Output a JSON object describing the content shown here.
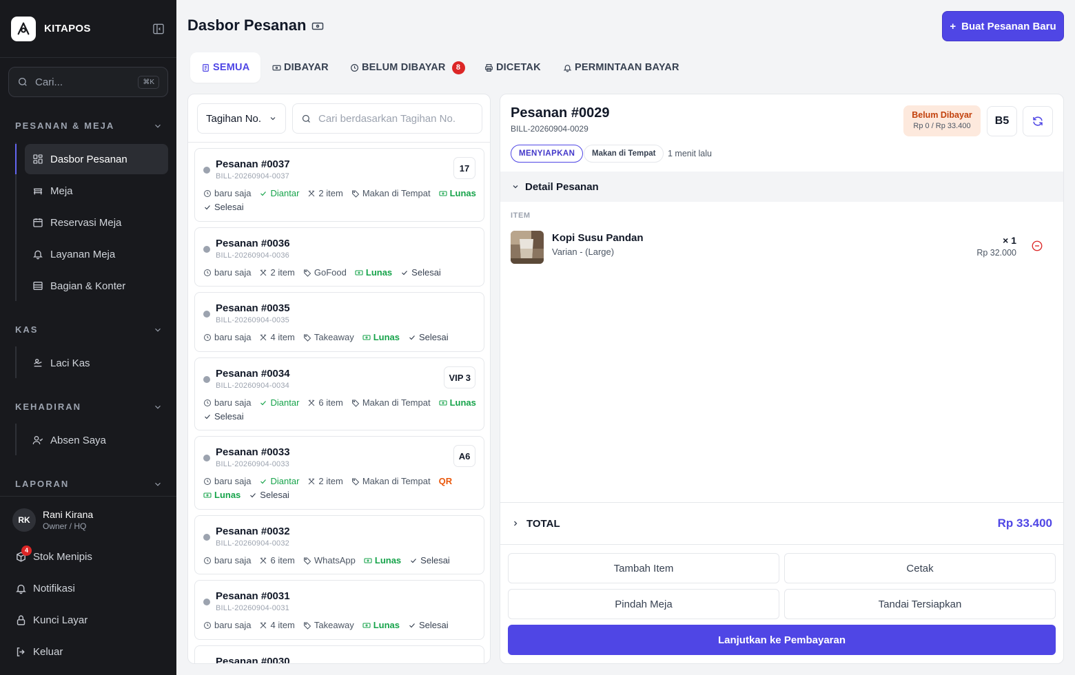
{
  "brand": {
    "name": "KITAPOS"
  },
  "sidebar": {
    "search": {
      "placeholder": "Cari...",
      "shortcut": "⌘K"
    },
    "sections": [
      {
        "title": "PESANAN & MEJA",
        "items": [
          {
            "label": "Dasbor Pesanan",
            "icon": "dashboard-icon",
            "active": true
          },
          {
            "label": "Meja",
            "icon": "table-icon"
          },
          {
            "label": "Reservasi Meja",
            "icon": "calendar-icon"
          },
          {
            "label": "Layanan Meja",
            "icon": "bell-icon"
          },
          {
            "label": "Bagian & Konter",
            "icon": "counter-icon"
          }
        ]
      },
      {
        "title": "KAS",
        "items": [
          {
            "label": "Laci Kas",
            "icon": "cash-icon"
          }
        ]
      },
      {
        "title": "KEHADIRAN",
        "items": [
          {
            "label": "Absen Saya",
            "icon": "user-check-icon"
          }
        ]
      },
      {
        "title": "LAPORAN",
        "items": []
      }
    ],
    "user": {
      "initials": "RK",
      "name": "Rani Kirana",
      "role": "Owner / HQ"
    },
    "bottom": [
      {
        "label": "Stok Menipis",
        "icon": "box-icon",
        "badge": "4"
      },
      {
        "label": "Notifikasi",
        "icon": "bell-icon"
      },
      {
        "label": "Kunci Layar",
        "icon": "lock-icon"
      },
      {
        "label": "Keluar",
        "icon": "logout-icon"
      }
    ]
  },
  "header": {
    "title": "Dasbor Pesanan",
    "new_order_label": "Buat Pesanan Baru"
  },
  "tabs": [
    {
      "label": "SEMUA",
      "icon": "document-icon",
      "active": true
    },
    {
      "label": "DIBAYAR",
      "icon": "money-icon"
    },
    {
      "label": "BELUM DIBAYAR",
      "icon": "clock-icon",
      "count": "8"
    },
    {
      "label": "DICETAK",
      "icon": "printer-icon"
    },
    {
      "label": "PERMINTAAN BAYAR",
      "icon": "bell-icon"
    }
  ],
  "list": {
    "filter_label": "Tagihan No.",
    "search_placeholder": "Cari berdasarkan Tagihan No.",
    "orders": [
      {
        "title": "Pesanan #0037",
        "bill": "BILL-20260904-0037",
        "table": "17",
        "meta": [
          {
            "t": "baru saja",
            "k": "time"
          },
          {
            "t": "Diantar",
            "k": "delivered"
          },
          {
            "t": "2 item",
            "k": "items"
          },
          {
            "t": "Makan di Tempat",
            "k": "type"
          },
          {
            "t": "Lunas",
            "k": "paid"
          },
          {
            "t": "Selesai",
            "k": "done"
          }
        ]
      },
      {
        "title": "Pesanan #0036",
        "bill": "BILL-20260904-0036",
        "table": "",
        "meta": [
          {
            "t": "baru saja",
            "k": "time"
          },
          {
            "t": "2 item",
            "k": "items"
          },
          {
            "t": "GoFood",
            "k": "type"
          },
          {
            "t": "Lunas",
            "k": "paid"
          },
          {
            "t": "Selesai",
            "k": "done"
          }
        ]
      },
      {
        "title": "Pesanan #0035",
        "bill": "BILL-20260904-0035",
        "table": "",
        "meta": [
          {
            "t": "baru saja",
            "k": "time"
          },
          {
            "t": "4 item",
            "k": "items"
          },
          {
            "t": "Takeaway",
            "k": "type"
          },
          {
            "t": "Lunas",
            "k": "paid"
          },
          {
            "t": "Selesai",
            "k": "done"
          }
        ]
      },
      {
        "title": "Pesanan #0034",
        "bill": "BILL-20260904-0034",
        "table": "VIP 3",
        "meta": [
          {
            "t": "baru saja",
            "k": "time"
          },
          {
            "t": "Diantar",
            "k": "delivered"
          },
          {
            "t": "6 item",
            "k": "items"
          },
          {
            "t": "Makan di Tempat",
            "k": "type"
          },
          {
            "t": "Lunas",
            "k": "paid"
          },
          {
            "t": "Selesai",
            "k": "done"
          }
        ]
      },
      {
        "title": "Pesanan #0033",
        "bill": "BILL-20260904-0033",
        "table": "A6",
        "meta": [
          {
            "t": "baru saja",
            "k": "time"
          },
          {
            "t": "Diantar",
            "k": "delivered"
          },
          {
            "t": "2 item",
            "k": "items"
          },
          {
            "t": "Makan di Tempat",
            "k": "type"
          },
          {
            "t": "QR",
            "k": "qr"
          },
          {
            "t": "Lunas",
            "k": "paid"
          },
          {
            "t": "Selesai",
            "k": "done"
          }
        ]
      },
      {
        "title": "Pesanan #0032",
        "bill": "BILL-20260904-0032",
        "table": "",
        "meta": [
          {
            "t": "baru saja",
            "k": "time"
          },
          {
            "t": "6 item",
            "k": "items"
          },
          {
            "t": "WhatsApp",
            "k": "type"
          },
          {
            "t": "Lunas",
            "k": "paid"
          },
          {
            "t": "Selesai",
            "k": "done"
          }
        ]
      },
      {
        "title": "Pesanan #0031",
        "bill": "BILL-20260904-0031",
        "table": "",
        "meta": [
          {
            "t": "baru saja",
            "k": "time"
          },
          {
            "t": "4 item",
            "k": "items"
          },
          {
            "t": "Takeaway",
            "k": "type"
          },
          {
            "t": "Lunas",
            "k": "paid"
          },
          {
            "t": "Selesai",
            "k": "done"
          }
        ]
      },
      {
        "title": "Pesanan #0030",
        "bill": "",
        "table": "",
        "meta": []
      }
    ]
  },
  "detail": {
    "title": "Pesanan #0029",
    "bill": "BILL-20260904-0029",
    "payment_status": "Belum Dibayar",
    "payment_amount": "Rp 0 / Rp 33.400",
    "table": "B5",
    "status_chip": "MENYIAPKAN",
    "type_chip": "Makan di Tempat",
    "time": "1 menit lalu",
    "section_label": "Detail Pesanan",
    "items_label": "ITEM",
    "item": {
      "name": "Kopi Susu Pandan",
      "variant": "Varian - (Large)",
      "qty": "× 1",
      "price": "Rp 32.000"
    },
    "total_label": "TOTAL",
    "total_value": "Rp 33.400",
    "actions": {
      "add_item": "Tambah Item",
      "print": "Cetak",
      "move_table": "Pindah Meja",
      "mark_ready": "Tandai Tersiapkan",
      "pay": "Lanjutkan ke Pembayaran"
    }
  }
}
